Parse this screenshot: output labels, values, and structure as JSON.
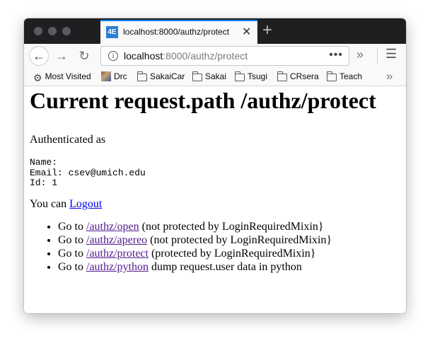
{
  "browser": {
    "tab": {
      "favicon": "4E",
      "title": "localhost:8000/authz/protect",
      "close_icon": "close-icon"
    },
    "newtab_icon": "plus-icon",
    "url": {
      "host": "localhost",
      "path": ":8000/authz/protect"
    },
    "bookmarks": [
      {
        "label": "Most Visited",
        "icon": "gear-icon"
      },
      {
        "label": "Drc",
        "icon": "drc-favicon"
      },
      {
        "label": "SakaiCar",
        "icon": "folder-icon"
      },
      {
        "label": "Sakai",
        "icon": "folder-icon"
      },
      {
        "label": "Tsugi",
        "icon": "folder-icon"
      },
      {
        "label": "CRsera",
        "icon": "folder-icon"
      },
      {
        "label": "Teach",
        "icon": "folder-icon"
      }
    ]
  },
  "page": {
    "heading": "Current request.path /authz/protect",
    "auth_label": "Authenticated as",
    "user_info": "Name: \nEmail: csev@umich.edu\nId: 1",
    "logout_prefix": "You can ",
    "logout_link": "Logout",
    "links": [
      {
        "prefix": "Go to ",
        "link": "/authz/open",
        "suffix": " (not protected by LoginRequiredMixin}"
      },
      {
        "prefix": "Go to ",
        "link": "/authz/apereo",
        "suffix": " (not protected by LoginRequiredMixin}"
      },
      {
        "prefix": "Go to ",
        "link": "/authz/protect",
        "suffix": " (protected by LoginRequiredMixin}"
      },
      {
        "prefix": "Go to ",
        "link": "/authz/python",
        "suffix": " dump request.user data in python"
      }
    ]
  }
}
